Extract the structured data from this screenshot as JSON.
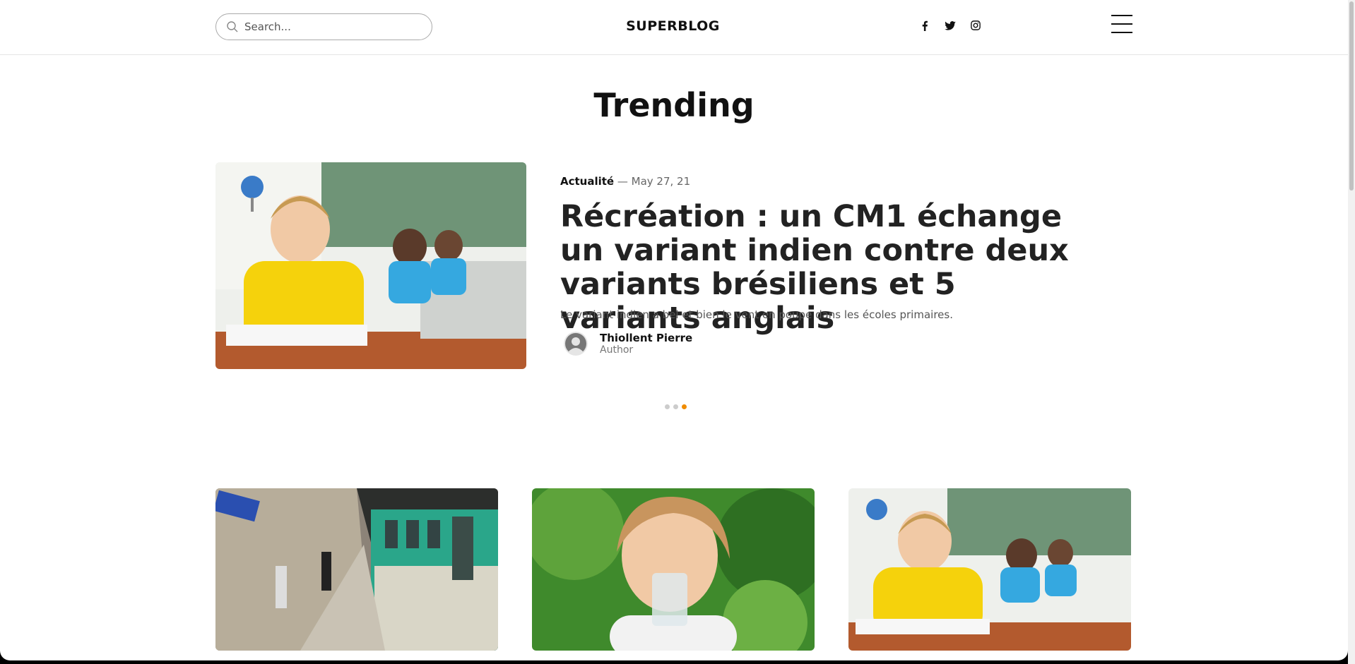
{
  "header": {
    "search_placeholder": "Search...",
    "brand": "SUPERBLOG",
    "socials": [
      "facebook-icon",
      "twitter-icon",
      "instagram-icon"
    ]
  },
  "trending": {
    "title": "Trending",
    "featured": {
      "category": "Actualité",
      "separator": " — ",
      "date": "May 27, 21",
      "headline": "Récréation : un CM1 échange un variant indien contre deux variants brésiliens et 5 variants anglais",
      "excerpt": "Le variant indien a bel et bien le vent en poupe dans les écoles primaires.",
      "author_name": "Thiollent Pierre",
      "author_role": "Author"
    },
    "carousel": {
      "count": 3,
      "active_index": 2
    }
  },
  "cards": [
    {
      "image": "metro-station-photo"
    },
    {
      "image": "girl-drinking-water-photo"
    },
    {
      "image": "classroom-children-photo"
    }
  ],
  "colors": {
    "accent": "#f08c00",
    "text": "#222222",
    "muted": "#666666"
  }
}
